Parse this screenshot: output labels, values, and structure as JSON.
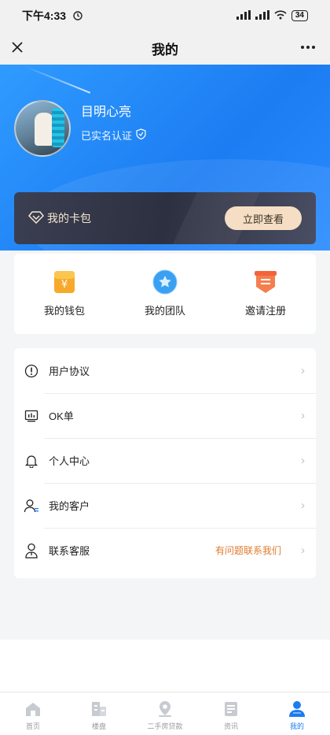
{
  "status_bar": {
    "time": "下午4:33",
    "battery": "34"
  },
  "nav": {
    "title": "我的"
  },
  "profile": {
    "name": "目明心亮",
    "verify_text": "已实名认证"
  },
  "wallet": {
    "label": "我的卡包",
    "button": "立即查看"
  },
  "quick_actions": [
    {
      "label": "我的钱包",
      "icon": "wallet-icon"
    },
    {
      "label": "我的团队",
      "icon": "team-icon"
    },
    {
      "label": "邀请注册",
      "icon": "invite-icon"
    }
  ],
  "menu": [
    {
      "label": "用户协议",
      "icon": "info-icon"
    },
    {
      "label": "OK单",
      "icon": "monitor-icon"
    },
    {
      "label": "个人中心",
      "icon": "bell-icon"
    },
    {
      "label": "我的客户",
      "icon": "customer-icon"
    },
    {
      "label": "联系客服",
      "icon": "service-icon",
      "extra": "有问题联系我们"
    }
  ],
  "tabs": [
    {
      "label": "首页",
      "icon": "home-icon"
    },
    {
      "label": "楼盘",
      "icon": "building-icon"
    },
    {
      "label": "二手房贷款",
      "icon": "loan-icon"
    },
    {
      "label": "资讯",
      "icon": "news-icon"
    },
    {
      "label": "我的",
      "icon": "profile-icon",
      "active": true
    }
  ],
  "colors": {
    "brand_blue": "#1c7cf2",
    "accent_orange": "#e07a2e",
    "tab_inactive": "#9a9a9a"
  }
}
